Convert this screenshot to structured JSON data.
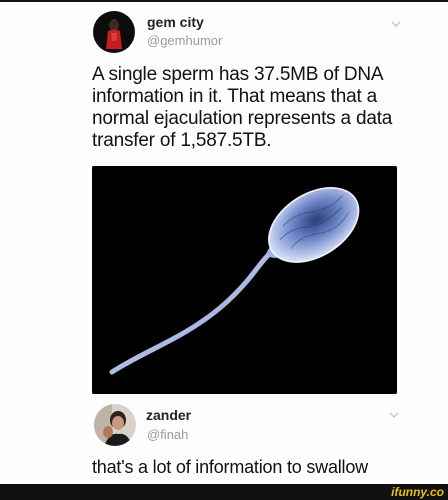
{
  "tweet": {
    "author_name": "gem city",
    "author_handle": "@gemhumor",
    "text_lines": [
      "A single sperm has 37.5MB of DNA",
      "information in it. That means that a",
      "normal ejaculation represents a data",
      "transfer of 1,587.5TB."
    ],
    "menu_icon": "chevron-down-icon"
  },
  "reply": {
    "author_name": "zander",
    "author_handle": "@finah",
    "text": "that's a lot of information to swallow",
    "menu_icon": "chevron-down-icon"
  },
  "watermark": "ifunny.co",
  "colors": {
    "background": "#fefefe",
    "handle": "#9a9a9a",
    "watermark": "#e8c200"
  }
}
